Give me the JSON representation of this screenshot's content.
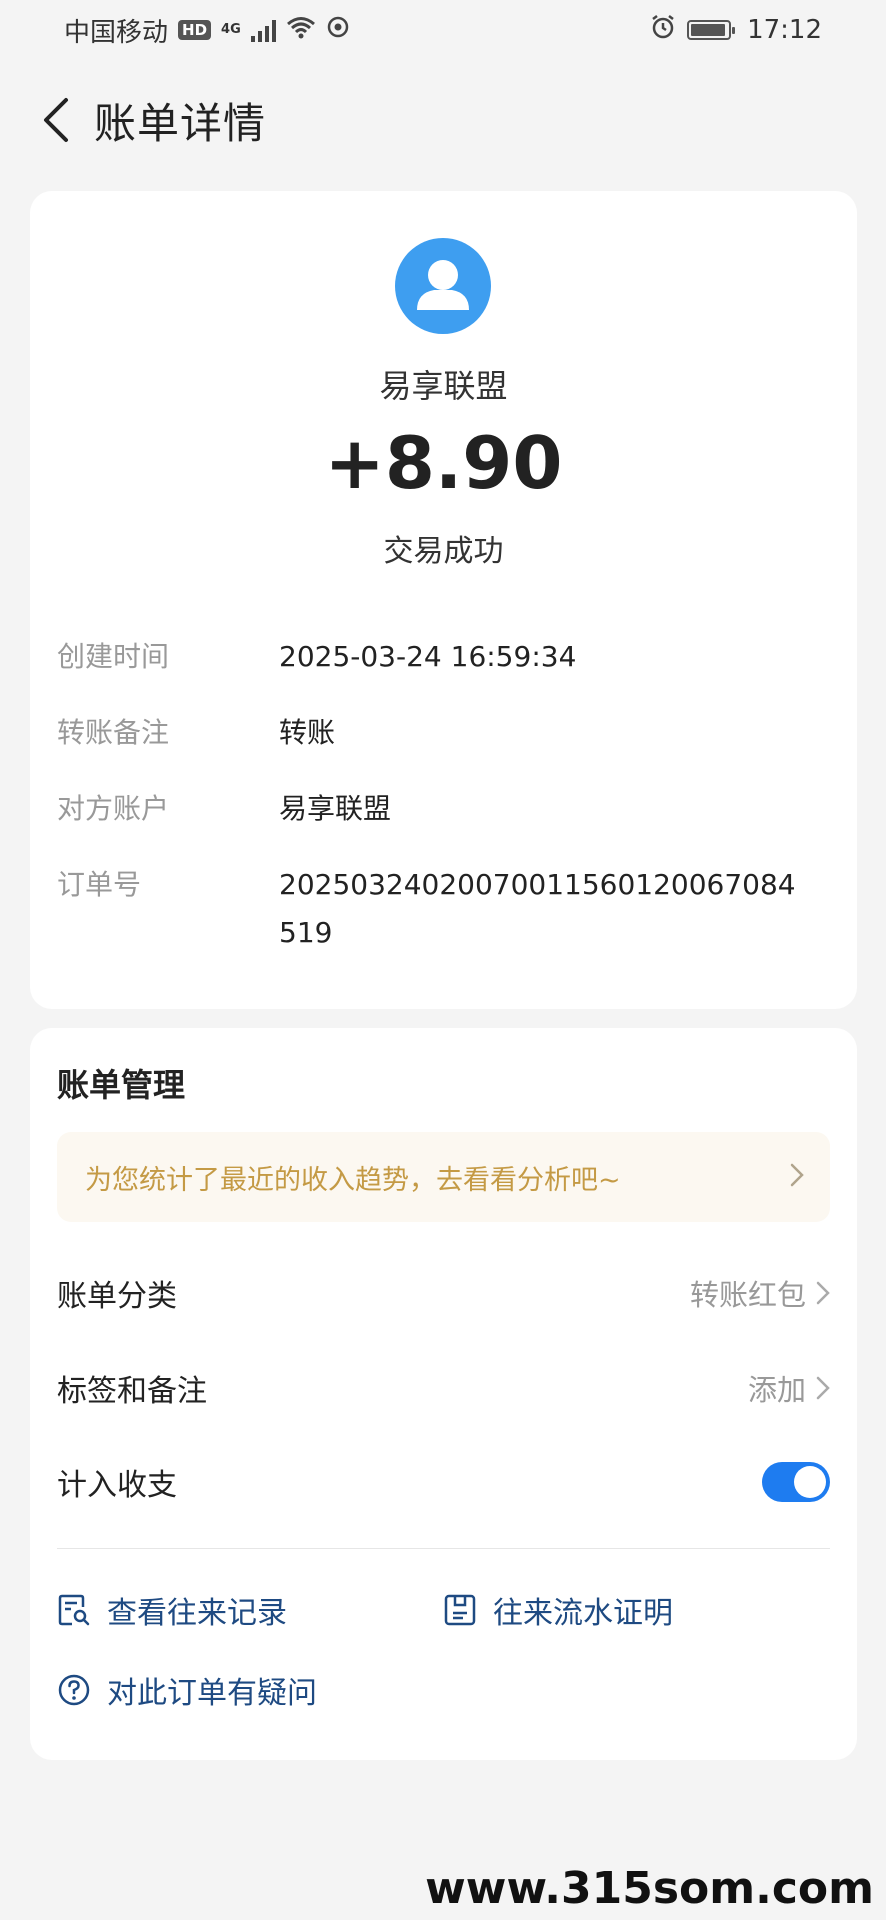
{
  "status_bar": {
    "carrier": "中国移动",
    "hd": "HD",
    "network": "4G",
    "time": "17:12"
  },
  "nav": {
    "title": "账单详情"
  },
  "bill": {
    "merchant": "易享联盟",
    "amount": "+8.90",
    "status": "交易成功",
    "details": [
      {
        "label": "创建时间",
        "value": "2025-03-24 16:59:34"
      },
      {
        "label": "转账备注",
        "value": "转账"
      },
      {
        "label": "对方账户",
        "value": "易享联盟"
      },
      {
        "label": "订单号",
        "value": "20250324020070011560120067084519"
      }
    ]
  },
  "management": {
    "title": "账单管理",
    "banner_text": "为您统计了最近的收入趋势，去看看分析吧~",
    "category_label": "账单分类",
    "category_value": "转账红包",
    "tags_label": "标签和备注",
    "tags_value": "添加",
    "include_label": "计入收支",
    "include_on": true,
    "links": {
      "records": "查看往来记录",
      "statement": "往来流水证明",
      "question": "对此订单有疑问"
    }
  },
  "watermark": "www.315som.com",
  "colors": {
    "accent": "#1e7cf0",
    "avatar_bg": "#3e9ef0",
    "link": "#1e4a82",
    "banner_text": "#c49a45",
    "banner_bg": "#fcf8f1"
  }
}
